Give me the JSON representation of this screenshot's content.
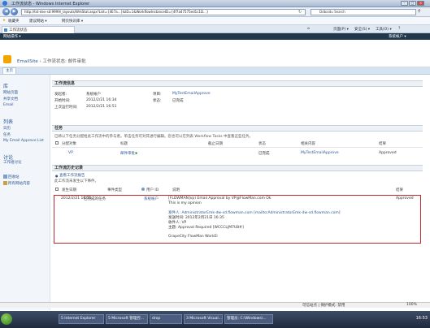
{
  "window": {
    "title": "工作流状态 - Windows Internet Explorer"
  },
  "browser": {
    "address": "http://tst-dev-sd:9999/_layouts/WrkStat.aspx?List={4E7a...}&ID=1&WorkflowInstanceID={4f7a47575ed1c1D...}",
    "search_placeholder": "Ddbaidu Search",
    "favorites_label": "收藏夹",
    "fav_items": [
      "建议网站 ▾",
      "网页快讯库 ▾"
    ],
    "tab_label": "工作流状态",
    "tools": [
      "页面(P) ▾",
      "安全(S) ▾",
      "工具(O) ▾",
      "?"
    ]
  },
  "sharepoint": {
    "site_actions": "网站操作 ▾",
    "user": "系统帐户 ▾",
    "breadcrumb_site": "EmailSite",
    "breadcrumb_sep": "›",
    "breadcrumb_page": "工作流状态: 邮件审批",
    "nav_home": "主页"
  },
  "quicklaunch": {
    "groups": [
      {
        "heading": "库",
        "items": [
          "网站页面",
          "共享文档",
          "Email"
        ]
      },
      {
        "heading": "列表",
        "items": [
          "日历",
          "任务",
          "My Email Approve List"
        ]
      },
      {
        "heading": "讨论",
        "items": [
          "工作组讨论"
        ]
      }
    ],
    "recycle": "回收站",
    "all_content": "所有网站内容"
  },
  "workflow_info": {
    "heading": "工作流信息",
    "initiator_label": "发起者:",
    "initiator": "系统帐户",
    "item_label": "项目:",
    "item": "MyTestEmailApprove",
    "started_label": "开始时间:",
    "started": "2012/2/21 16:34",
    "status_label": "状态:",
    "status": "已完成",
    "lastrun_label": "上次运行时间:",
    "lastrun": "2012/2/21 16:51"
  },
  "tasks": {
    "heading": "任务",
    "description": "已将以下任务分配给此工作流中的参与者。单击任务可对其进行编辑。您也可以在列表 Workflow Tasks 中查看这些任务。",
    "columns": [
      "分配对象",
      "标题",
      "截止日期",
      "状态",
      "相关内容",
      "结果"
    ],
    "rows": [
      {
        "assignee": "VP",
        "title": "邮件审批",
        "due": "",
        "status": "已完成",
        "related": "MyTestEmailApprove",
        "outcome": "Approved"
      }
    ]
  },
  "history": {
    "heading": "工作流历史记录",
    "view_report": "查看工作流报告",
    "note": "此工作流未发生以下事件。",
    "columns": [
      "发生日期",
      "事件类型",
      "用户 ID",
      "说明",
      "结果"
    ],
    "rows": [
      {
        "date": "2012/2/21 16:51",
        "event": "已完成的任务",
        "user": "系统帐户",
        "description_lines": [
          "[FLOWMAN]vp) Email Approval by VP@FlowMan.com Ok",
          "This is my opinion",
          "",
          "发件人: AdministratorEmk-dw-sd.flowman.com [mailto:AdministratorEmk-dw-sd.flowman.com]",
          "发送时间: 2012年2月21日 16:35",
          "收件人: VP",
          "主题: Approval Required [WCCCLJM7U8#]",
          "",
          "GrapeCity FlowMan WorkEl"
        ],
        "outcome": "Approved"
      }
    ]
  },
  "statusbar": {
    "zone": "可信站点 | 保护模式: 禁用",
    "zoom": "100%"
  },
  "taskbar": {
    "buttons": [
      "5 Internet Explorer",
      "5 Microsoft 管理控...",
      "drop",
      "3 Microsoft Visual...",
      "管理员: C:\\Windows\\..."
    ],
    "clock": "16:53"
  }
}
